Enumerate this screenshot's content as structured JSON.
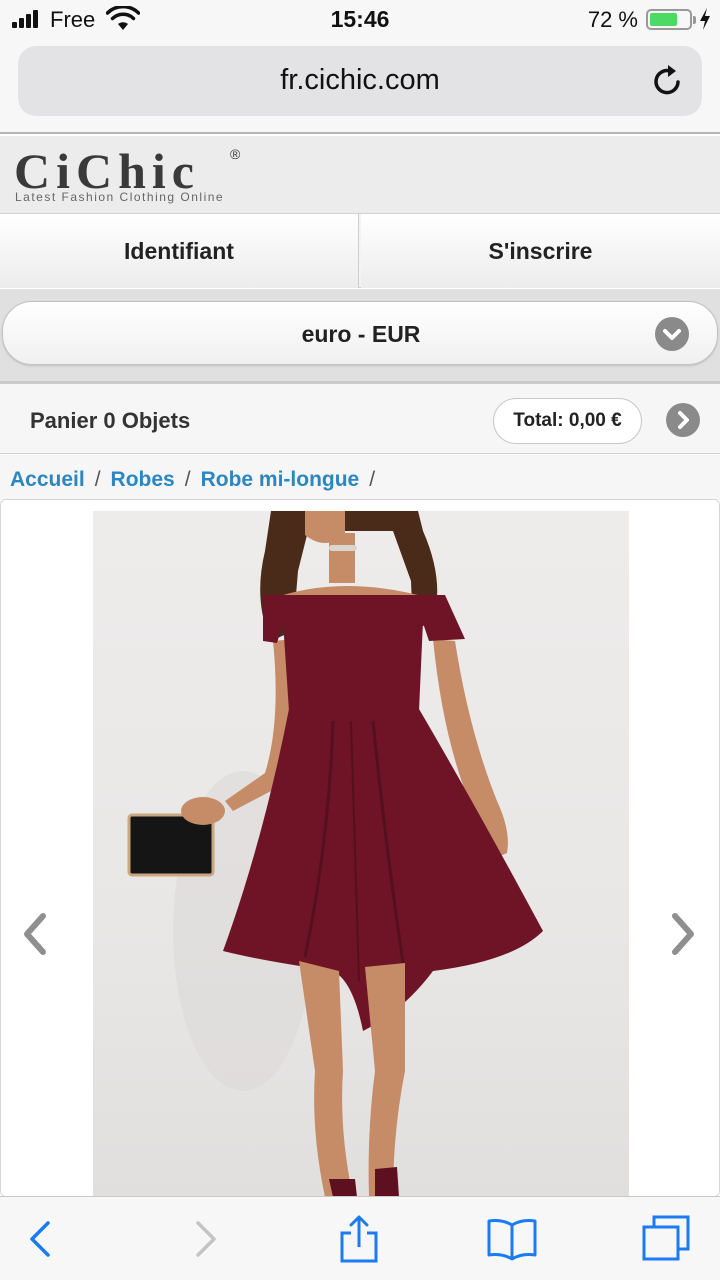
{
  "status_bar": {
    "carrier": "Free",
    "time": "15:46",
    "battery_text": "72 %",
    "battery_level": 0.72,
    "battery_color": "#4cd964"
  },
  "browser": {
    "url": "fr.cichic.com",
    "reload_icon": "reload-icon"
  },
  "header": {
    "logo_name": "CiChic",
    "logo_reg": "®",
    "logo_tagline": "Latest Fashion Clothing Online"
  },
  "auth": {
    "login_label": "Identifiant",
    "signup_label": "S'inscrire"
  },
  "currency": {
    "selected": "euro - EUR",
    "icon": "chevron-down-icon"
  },
  "cart": {
    "label": "Panier 0 Objets",
    "total": "Total: 0,00 €",
    "go_icon": "chevron-right-icon"
  },
  "breadcrumb": {
    "items": [
      "Accueil",
      "Robes",
      "Robe mi-longue"
    ],
    "separator": "/"
  },
  "product": {
    "image_subject": "woman-in-burgundy-off-shoulder-dress",
    "dress_color": "#6e1426",
    "prev_icon": "chevron-left-icon",
    "next_icon": "chevron-right-icon"
  },
  "toolbar": {
    "icons": [
      "back-icon",
      "forward-icon",
      "share-icon",
      "bookmarks-icon",
      "tabs-icon"
    ],
    "accent": "#1a7bf2"
  }
}
